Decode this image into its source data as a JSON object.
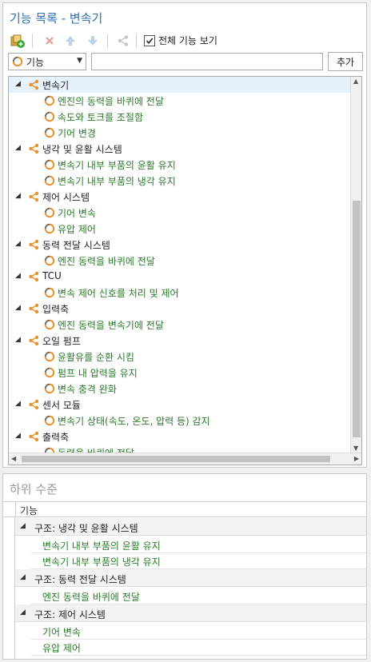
{
  "panel": {
    "title": "기능 목록 - 변속기"
  },
  "toolbar": {
    "show_all_label": "전체 기능 보기",
    "show_all_checked": true
  },
  "filter": {
    "selected": "기능",
    "search_value": "",
    "add_label": "추가"
  },
  "tree": [
    {
      "kind": "group",
      "label": "변속기",
      "selected": true
    },
    {
      "kind": "fn",
      "label": "엔진의 동력을 바퀴에 전달"
    },
    {
      "kind": "fn",
      "label": "속도와 토크를 조절함"
    },
    {
      "kind": "fn",
      "label": "기어 변경"
    },
    {
      "kind": "group",
      "label": "냉각 및 윤활 시스템"
    },
    {
      "kind": "fn",
      "label": "변속기 내부 부품의 윤활 유지"
    },
    {
      "kind": "fn",
      "label": "변속기 내부 부품의 냉각 유지"
    },
    {
      "kind": "group",
      "label": "제어 시스템"
    },
    {
      "kind": "fn",
      "label": "기어 변속"
    },
    {
      "kind": "fn",
      "label": "유압 제어"
    },
    {
      "kind": "group",
      "label": "동력 전달 시스템"
    },
    {
      "kind": "fn",
      "label": "엔진 동력을 바퀴에 전달"
    },
    {
      "kind": "group",
      "label": "TCU"
    },
    {
      "kind": "fn",
      "label": "변속 제어 신호를 처리 및 제어"
    },
    {
      "kind": "group",
      "label": "입력축"
    },
    {
      "kind": "fn",
      "label": "엔진 동력을 변속기에 전달"
    },
    {
      "kind": "group",
      "label": "오일 펌프"
    },
    {
      "kind": "fn",
      "label": "윤활유를 순환 시킴"
    },
    {
      "kind": "fn",
      "label": "펌프 내 압력을 유지"
    },
    {
      "kind": "fn",
      "label": "변속 충격 완화"
    },
    {
      "kind": "group",
      "label": "센서 모듈"
    },
    {
      "kind": "fn",
      "label": "변속기 상태(속도, 온도, 압력 등) 감지"
    },
    {
      "kind": "group",
      "label": "출력축"
    },
    {
      "kind": "fn",
      "label": "동력을 바퀴에 전달"
    }
  ],
  "sub": {
    "title": "하위 수준",
    "column": "기능",
    "groups": [
      {
        "label": "구조: 냉각 및 윤활 시스템",
        "items": [
          "변속기 내부 부품의 윤활 유지",
          "변속기 내부 부품의 냉각 유지"
        ]
      },
      {
        "label": "구조: 동력 전달 시스템",
        "items": [
          "엔진 동력을 바퀴에 전달"
        ]
      },
      {
        "label": "구조: 제어 시스템",
        "items": [
          "기어 변속",
          "유압 제어"
        ]
      }
    ]
  },
  "colors": {
    "accent": "#2e6fb5",
    "function_text": "#2a7a2a",
    "group_icon": "#e8912d",
    "selection": "#e5f1fb"
  }
}
